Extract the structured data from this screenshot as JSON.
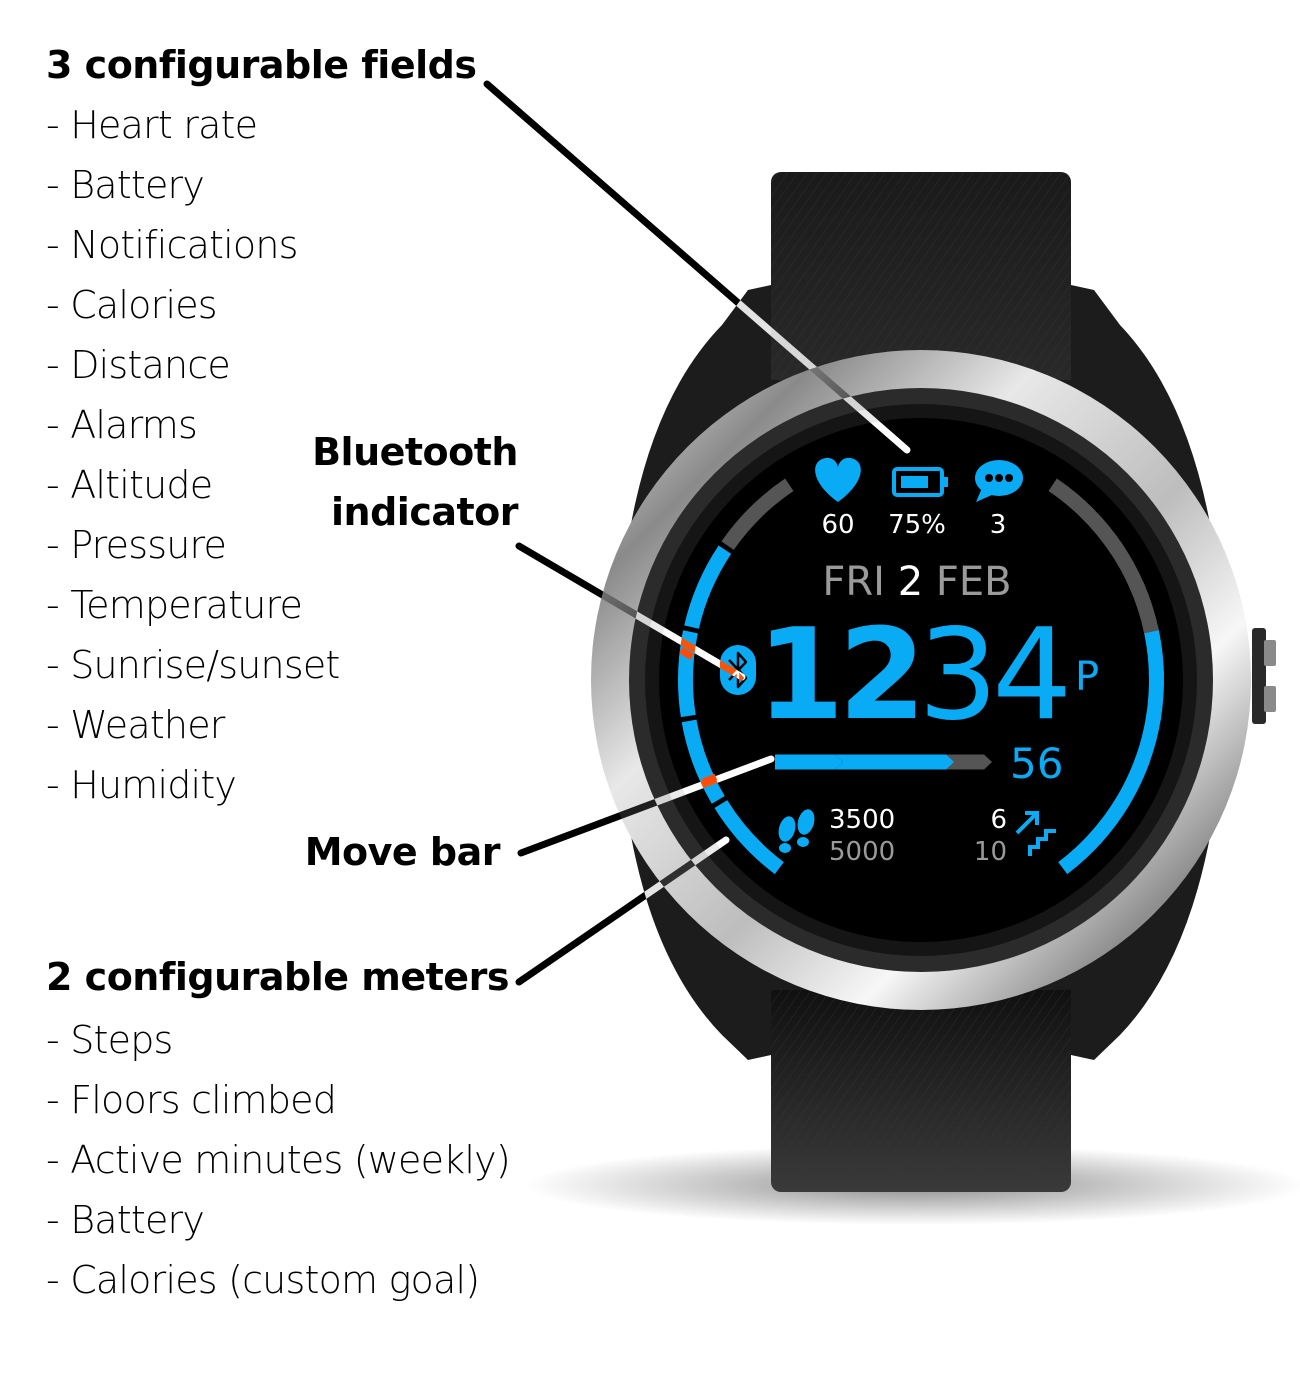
{
  "fields_section": {
    "heading": "3 configurable fields",
    "items": [
      "Heart rate",
      "Battery",
      "Notifications",
      "Calories",
      "Distance",
      "Alarms",
      "Altitude",
      "Pressure",
      "Temperature",
      "Sunrise/sunset",
      "Weather",
      "Humidity"
    ]
  },
  "meters_section": {
    "heading": "2 configurable meters",
    "items": [
      "Steps",
      "Floors climbed",
      "Active minutes (weekly)",
      "Battery",
      "Calories (custom goal)"
    ]
  },
  "callouts": {
    "bluetooth_line1": "Bluetooth",
    "bluetooth_line2": "indicator",
    "move_bar": "Move bar"
  },
  "colors": {
    "accent": "#0aabf5",
    "inactive": "#555555",
    "date_gray": "#9a9a9a",
    "marker": "#ff4a0a"
  },
  "watch_face": {
    "fields": [
      {
        "icon": "heart-icon",
        "value": "60"
      },
      {
        "icon": "battery-icon",
        "value": "75%"
      },
      {
        "icon": "notification-icon",
        "value": "3"
      }
    ],
    "date": {
      "weekday": "FRI",
      "day": "2",
      "month": "FEB"
    },
    "time": {
      "hours": "12",
      "minutes": "34",
      "ampm": "P"
    },
    "seconds": "56",
    "bluetooth_connected": true,
    "move_bar": {
      "filled_segments": 4,
      "total_segments": 5
    },
    "steps": {
      "current": "3500",
      "goal": "5000",
      "fill": 0.7,
      "segments": 5
    },
    "floors": {
      "current": "6",
      "goal": "10",
      "fill": 0.6,
      "segments": 10
    }
  }
}
